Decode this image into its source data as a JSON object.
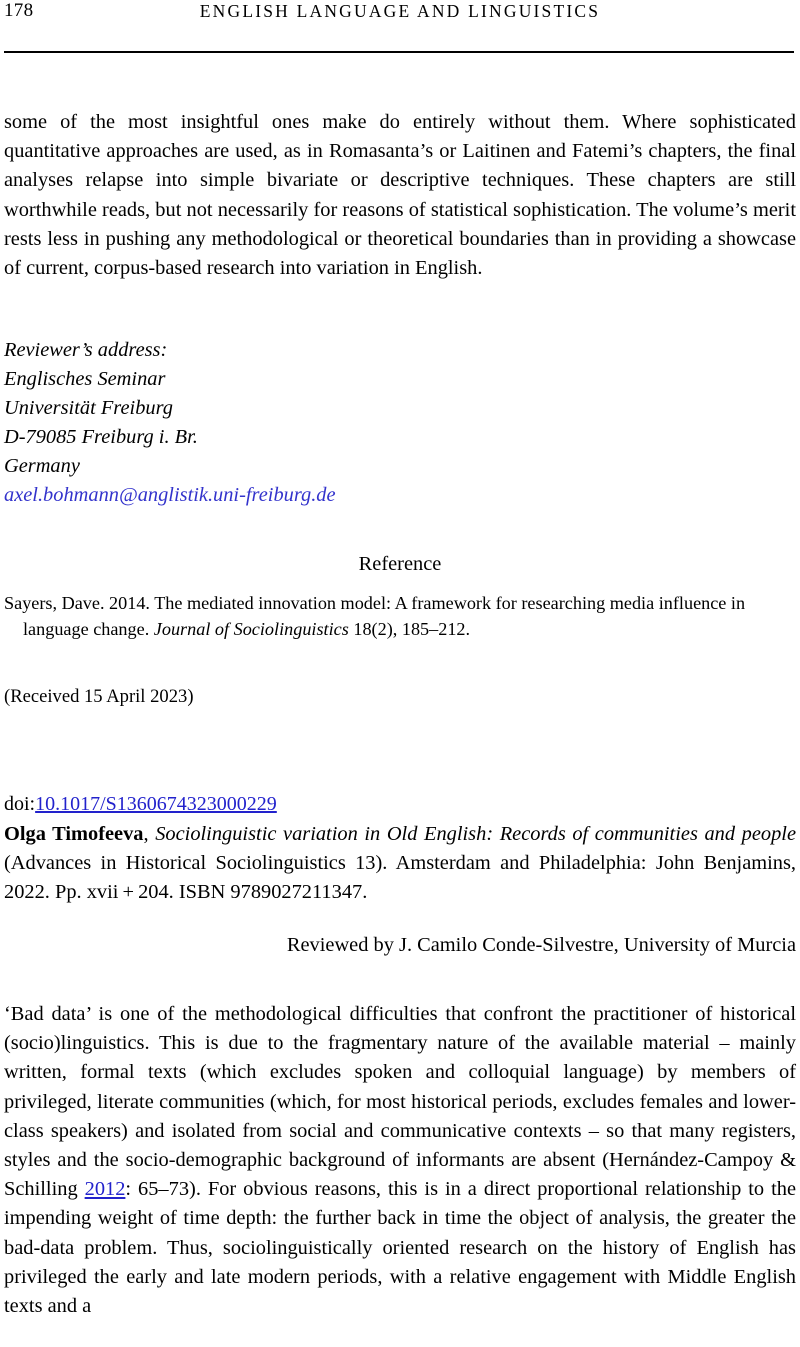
{
  "header": {
    "folio": "178",
    "running_title": "ENGLISH LANGUAGE AND LINGUISTICS"
  },
  "review_one": {
    "closing_paragraph": "some of the most insightful ones make do entirely without them. Where sophisticated quantitative approaches are used, as in Romasanta’s or Laitinen and Fatemi’s chapters, the final analyses relapse into simple bivariate or descriptive techniques. These chapters are still worthwhile reads, but not necessarily for reasons of statistical sophistication. The volume’s merit rests less in pushing any methodological or theoretical boundaries than in providing a showcase of current, corpus-based research into variation in English.",
    "address": {
      "label": "Reviewer’s address:",
      "line1": "Englisches Seminar",
      "line2": "Universität Freiburg",
      "line3": "D-79085 Freiburg i. Br.",
      "line4": "Germany",
      "email": "axel.bohmann@anglistik.uni-freiburg.de"
    },
    "reference_heading": "Reference",
    "reference_entry": {
      "pre_italic": "Sayers, Dave. 2014. The mediated innovation model: A framework for researching media influence in language change. ",
      "italic": "Journal of Sociolinguistics",
      "post_italic": " 18(2), 185–212."
    },
    "received": "(Received 15 April 2023)"
  },
  "review_two": {
    "doi_label": "doi:",
    "doi_number": "10.1017/S1360674323000229",
    "author": "Olga Timofeeva",
    "title_part1": ", ",
    "title_italic": "Sociolinguistic variation in Old English: Records of communities and people",
    "title_rest": " (Advances in Historical Sociolinguistics 13). Amsterdam and Philadelphia: John Benjamins, 2022. Pp. xvii + 204. ISBN 9789027211347.",
    "reviewed_by": "Reviewed by J. Camilo Conde-Silvestre, University of Murcia",
    "opening_paragraph_part1": "‘Bad data’ is one of the methodological difficulties that confront the practitioner of historical (socio)linguistics. This is due to the fragmentary nature of the available material – mainly written, formal texts (which excludes spoken and colloquial language) by members of privileged, literate communities (which, for most historical periods, excludes females and lower-class speakers) and isolated from social and communicative contexts – so that many registers, styles and the socio-demographic background of informants are absent (Hernández-Campoy & Schilling ",
    "citation_year": "2012",
    "opening_paragraph_part2": ": 65–73). For obvious reasons, this is in a direct proportional relationship to the impending weight of time depth: the further back in time the object of analysis, the greater the bad-data problem. Thus, sociolinguistically oriented research on the history of English has privileged the early and late modern periods, with a relative engagement with Middle English texts and a"
  },
  "colors": {
    "link_blue": "#3333cc",
    "doi_blue": "#2222cc",
    "text_black": "#000000"
  }
}
